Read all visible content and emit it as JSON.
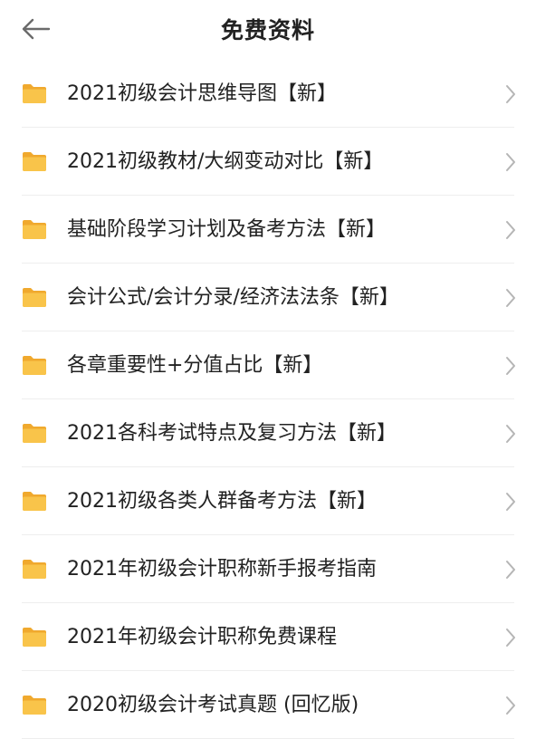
{
  "header": {
    "title": "免费资料",
    "back_icon": "arrow-left-icon"
  },
  "colors": {
    "folder": "#F9C44A",
    "folder_dark": "#F0A92E",
    "chevron": "#b5b5b5",
    "divider": "#eeeeee"
  },
  "list": {
    "items": [
      {
        "label": "2021初级会计思维导图【新】",
        "icon": "folder-icon"
      },
      {
        "label": "2021初级教材/大纲变动对比【新】",
        "icon": "folder-icon"
      },
      {
        "label": "基础阶段学习计划及备考方法【新】",
        "icon": "folder-icon"
      },
      {
        "label": "会计公式/会计分录/经济法法条【新】",
        "icon": "folder-icon"
      },
      {
        "label": "各章重要性+分值占比【新】",
        "icon": "folder-icon"
      },
      {
        "label": "2021各科考试特点及复习方法【新】",
        "icon": "folder-icon"
      },
      {
        "label": "2021初级各类人群备考方法【新】",
        "icon": "folder-icon"
      },
      {
        "label": "2021年初级会计职称新手报考指南",
        "icon": "folder-icon"
      },
      {
        "label": "2021年初级会计职称免费课程",
        "icon": "folder-icon"
      },
      {
        "label": "2020初级会计考试真题 (回忆版)",
        "icon": "folder-icon"
      }
    ]
  }
}
